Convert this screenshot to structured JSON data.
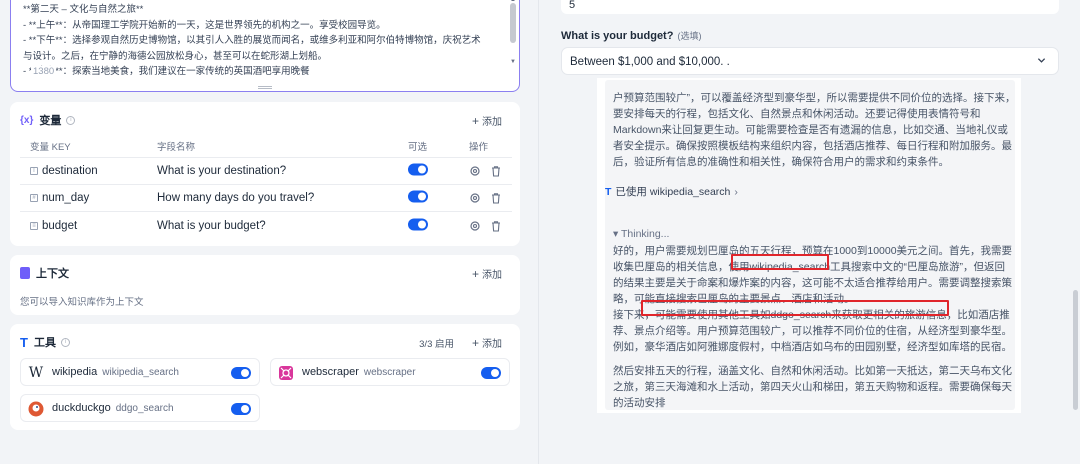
{
  "prompt": {
    "lines": [
      "**第二天 – 文化与自然之旅**",
      "- **上午**：从帝国理工学院开始新的一天，这是世界领先的机构之一。享受校园导览。",
      "- **下午**：选择参观自然历史博物馆，以其引人入胜的展览而闻名，或维多利亚和阿尔伯特博物馆，庆祝艺术",
      "与设计。之后，在宁静的海德公园放松身心，甚至可以在蛇形湖上划船。",
      "- **晚上**：探索当地美食，我们建议在一家传统的英国酒吧享用晚餐"
    ],
    "char_count": "1380"
  },
  "variables": {
    "title": "变量",
    "add_label": "添加",
    "headers": {
      "key": "变量 KEY",
      "name": "字段名称",
      "optional": "可选",
      "ops": "操作"
    },
    "rows": [
      {
        "key": "destination",
        "name": "What is your destination?"
      },
      {
        "key": "num_day",
        "name": "How many days do you travel?"
      },
      {
        "key": "budget",
        "name": "What is your budget?"
      }
    ]
  },
  "context": {
    "title": "上下文",
    "add_label": "添加",
    "description": "您可以导入知识库作为上下文"
  },
  "tools": {
    "title": "工具",
    "count": "3/3 启用",
    "add_label": "添加",
    "items": [
      {
        "name": "wikipedia",
        "id": "wikipedia_search",
        "icon": "wikipedia-logo"
      },
      {
        "name": "webscraper",
        "id": "webscraper",
        "icon": "webscraper-logo"
      },
      {
        "name": "duckduckgo",
        "id": "ddgo_search",
        "icon": "duckduckgo-logo"
      }
    ]
  },
  "form": {
    "num_day_value": "5",
    "budget_label": "What is your budget?",
    "budget_optional": "(选填)",
    "budget_value": "Between $1,000 and $10,000. ."
  },
  "reply": {
    "think1_lines": [
      "户预算范围较广”，可以覆盖经济型到豪华型，所以需要提供不同价位的选择。接下来，",
      "要安排每天的行程，包括文化、自然景点和休闲活动。还要记得使用表情符号和",
      "Markdown来让回复更生动。可能需要检查是否有遗漏的信息，比如交通、当地礼仪或",
      "者安全提示。确保按照模板结构来组织内容，包括酒店推荐、每日行程和附加服务。最",
      "后，验证所有信息的准确性和相关性，确保符合用户的需求和约束条件。"
    ],
    "tool_used": "已使用 wikipedia_search",
    "thinking_label": "▾ Thinking...",
    "think2_lines": [
      "好的，用户需要规划巴厘岛的五天行程，预算在1000到10000美元之间。首先，我需要",
      "收集巴厘岛的相关信息，使用wikipedia_search工具搜索中文的“巴厘岛旅游”，但返回",
      "的结果主要是关于命案和爆炸案的内容，这可能不太适合推荐给用户。需要调整搜索策",
      "略，可能直接搜索巴厘岛的主要景点、酒店和活动。",
      "接下来，可能需要使用其他工具如ddgo_search来获取更相关的旅游信息，比如酒店推",
      "荐、景点介绍等。用户预算范围较广，可以推荐不同价位的住宿，从经济型到豪华型。",
      "例如，豪华酒店如阿雅娜度假村，中档酒店如乌布的田园别墅，经济型如库塔的民宿。",
      "",
      "然后安排五天的行程，涵盖文化、自然和休闲活动。比如第一天抵达，第二天乌布文化",
      "之旅，第三天海滩和水上活动，第四天火山和梯田，第五天购物和返程。需要确保每天",
      "的活动安排"
    ]
  }
}
